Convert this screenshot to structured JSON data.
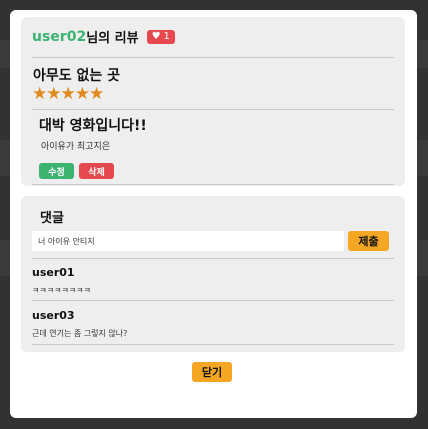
{
  "review": {
    "username": "user02",
    "header_suffix": "님의 리뷰",
    "like_icon": "heart-icon",
    "like_count": "1",
    "movie_title": "아무도 없는 곳",
    "rating": 5,
    "stars": "★★★★★",
    "title": "대박 영화입니다!!",
    "body": "아이유가 최고지은",
    "edit_label": "수정",
    "delete_label": "삭제"
  },
  "comments": {
    "heading": "댓글",
    "input_value": "너 아이유 안티지",
    "submit_label": "제출",
    "items": [
      {
        "author": "user01",
        "text": "ㅋㅋㅋㅋㅋㅋㅋㅋ"
      },
      {
        "author": "user03",
        "text": "근데 연기는 좀 그렇지 않나?"
      }
    ]
  },
  "close_label": "닫기",
  "colors": {
    "username": "#3cb371",
    "like_badge": "#e5484d",
    "stars": "#e08a1e",
    "edit_button": "#3cb371",
    "delete_button": "#e5484d",
    "accent_button": "#f5a623"
  }
}
